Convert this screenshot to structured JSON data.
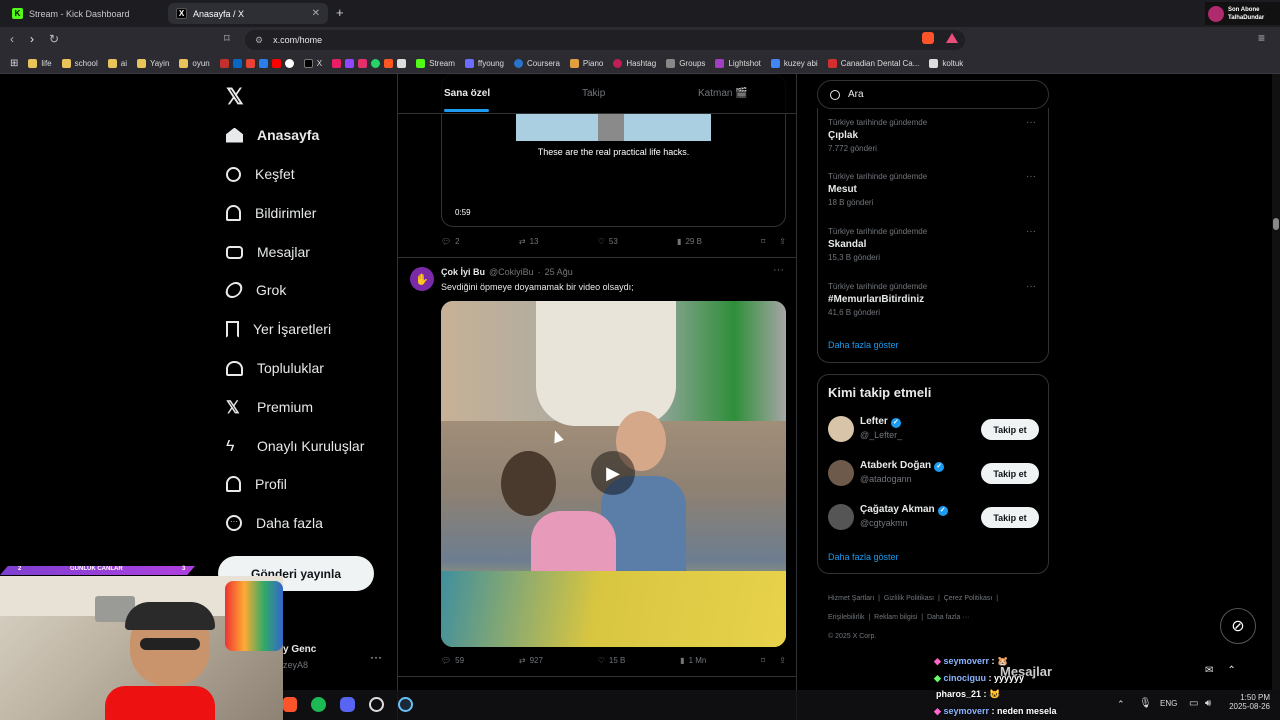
{
  "browser": {
    "tabs": [
      {
        "label": "Stream - Kick Dashboard",
        "favicon": "K"
      },
      {
        "label": "Anasayfa / X",
        "favicon": "X"
      }
    ],
    "new_tab": "+",
    "url": "x.com/home",
    "bookmarks": [
      "life",
      "school",
      "ai",
      "Yayin",
      "oyun",
      "X",
      "Stream",
      "ffyoung",
      "Coursera",
      "Piano",
      "Hashtag",
      "Groups",
      "Lightshot",
      "kuzey abi",
      "Canadian Dental Ca...",
      "koltuk"
    ],
    "overlay_badge": {
      "line1": "Son Abone",
      "line2": "TalhaDundar"
    }
  },
  "sidebar": {
    "items": [
      {
        "label": "Anasayfa",
        "icon": "home-icon"
      },
      {
        "label": "Keşfet",
        "icon": "search-icon"
      },
      {
        "label": "Bildirimler",
        "icon": "bell-icon"
      },
      {
        "label": "Mesajlar",
        "icon": "mail-icon"
      },
      {
        "label": "Grok",
        "icon": "grok-icon"
      },
      {
        "label": "Yer İşaretleri",
        "icon": "bookmark-icon"
      },
      {
        "label": "Topluluklar",
        "icon": "people-icon"
      },
      {
        "label": "Premium",
        "icon": "x-logo-icon"
      },
      {
        "label": "Onaylı Kuruluşlar",
        "icon": "bolt-icon"
      },
      {
        "label": "Profil",
        "icon": "person-icon"
      },
      {
        "label": "Daha fazla",
        "icon": "more-circle-icon"
      }
    ],
    "post_button": "Gönderi yayınla",
    "account": {
      "name": "y Genc",
      "handle": "zeyA8"
    }
  },
  "feed": {
    "tabs": [
      "Sana özel",
      "Takip",
      "Katman 🎬"
    ],
    "tweet1": {
      "caption": "These are the real practical life hacks.",
      "duration": "0:59",
      "replies": "2",
      "reposts": "13",
      "likes": "53",
      "views": "29 B"
    },
    "tweet2": {
      "name": "Çok İyi Bu",
      "handle": "@CokiyiBu",
      "date": "25 Ağu",
      "text": "Sevdiğini öpmeye doyamamak bir video olsaydı;",
      "replies": "59",
      "reposts": "927",
      "likes": "15 B",
      "views": "1 Mn"
    }
  },
  "right": {
    "search_placeholder": "Ara",
    "trends": [
      {
        "context": "Türkiye tarihinde gündemde",
        "title": "Çıplak",
        "count": "7.772 gönderi"
      },
      {
        "context": "Türkiye tarihinde gündemde",
        "title": "Mesut",
        "count": "18 B gönderi"
      },
      {
        "context": "Türkiye tarihinde gündemde",
        "title": "Skandal",
        "count": "15,3 B gönderi"
      },
      {
        "context": "Türkiye tarihinde gündemde",
        "title": "#MemurlarıBitirdiniz",
        "count": "41,6 B gönderi"
      }
    ],
    "show_more": "Daha fazla göster",
    "who_to_follow_title": "Kimi takip etmeli",
    "follows": [
      {
        "name": "Lefter",
        "handle": "@_Lefter_",
        "button": "Takip et"
      },
      {
        "name": "Ataberk Doğan",
        "handle": "@atadogann",
        "button": "Takip et"
      },
      {
        "name": "Çağatay Akman",
        "handle": "@cgtyakmn",
        "button": "Takip et"
      }
    ],
    "footer": [
      "Hizmet Şartları",
      "Gizlilik Politikası",
      "Çerez Politikası",
      "Erişilebilirlik",
      "Reklam bilgisi",
      "Daha fazla ···",
      "© 2025 X Corp."
    ],
    "messages_label": "Mesajlar"
  },
  "stream": {
    "bar": {
      "left": "2",
      "center": "GUNLUK CANLAR",
      "right": "3"
    },
    "chat": [
      {
        "user": "seymoverr",
        "msg": "🐹"
      },
      {
        "user": "cinociguu",
        "msg": "yyyyyy"
      },
      {
        "user": "pharos_21",
        "msg": "😺"
      },
      {
        "user": "seymoverr",
        "msg": "neden mesela"
      }
    ]
  },
  "taskbar": {
    "lang": "ENG",
    "time": "1:50 PM",
    "date": "2025-08-26"
  },
  "colors": {
    "accent": "#1d9bf0",
    "bg": "#000000",
    "border": "#2f3336"
  }
}
